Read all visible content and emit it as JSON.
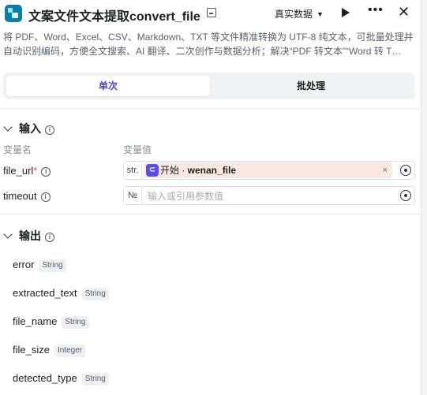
{
  "header": {
    "title": "文案文件文本提取convert_file",
    "data_mode": "真实数据"
  },
  "description": "将 PDF、Word、Excel、CSV、Markdown、TXT 等文件精准转换为 UTF-8 纯文本，可批量处理并自动识别编码，方便全文搜索、AI 翻译、二次创作与数据分析；解决“PDF 转文本”“Word 转 T…",
  "tabs": {
    "single": "单次",
    "batch": "批处理"
  },
  "input": {
    "title": "输入",
    "col_name": "变量名",
    "col_value": "变量值",
    "rows": [
      {
        "name": "file_url",
        "required": "*",
        "type": "str.",
        "ref_node": "开始 · ",
        "ref_var": "wenan_file",
        "clear": "×"
      },
      {
        "name": "timeout",
        "type": "№",
        "placeholder": "输入或引用参数值"
      }
    ]
  },
  "output": {
    "title": "输出",
    "items": [
      {
        "name": "error",
        "type": "String"
      },
      {
        "name": "extracted_text",
        "type": "String"
      },
      {
        "name": "file_name",
        "type": "String"
      },
      {
        "name": "file_size",
        "type": "Integer"
      },
      {
        "name": "detected_type",
        "type": "String"
      }
    ]
  },
  "colors": {
    "accent": "#4e40e5",
    "ref_bg": "#f9e9e0",
    "required": "#e5484d"
  },
  "icons": {
    "app": "app-logo-icon",
    "edit": "edit-icon",
    "play": "play-icon",
    "more": "more-icon",
    "close": "close-icon",
    "info": "info-icon",
    "chevron": "chevron-down-icon",
    "target": "target-icon"
  }
}
